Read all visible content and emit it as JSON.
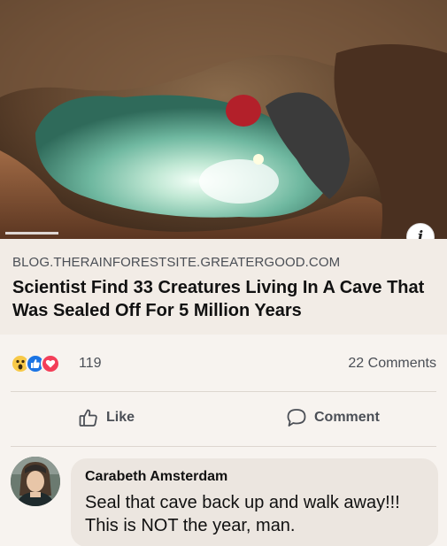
{
  "post": {
    "image_alt": "Caver with headlamp looking into a turquoise pool inside a cave",
    "info_icon": "info-icon"
  },
  "link": {
    "domain": "BLOG.THERAINFORESTSITE.GREATERGOOD.COM",
    "title": "Scientist Find 33 Creatures Living In A Cave That Was Sealed Off For 5 Million Years"
  },
  "stats": {
    "reaction_icons": [
      "wow-reaction-icon",
      "like-reaction-icon",
      "love-reaction-icon"
    ],
    "reaction_count": "119",
    "comments": "22 Comments"
  },
  "actions": {
    "like_label": "Like",
    "comment_label": "Comment"
  },
  "comment": {
    "author": "Carabeth Amsterdam",
    "text": "Seal that cave back up and walk away!!! This is NOT the year, man."
  },
  "colors": {
    "like_blue": "#1b74e4",
    "love_red": "#f33e58",
    "wow_yellow": "#f7c948",
    "text_secondary": "#4b4f56"
  }
}
